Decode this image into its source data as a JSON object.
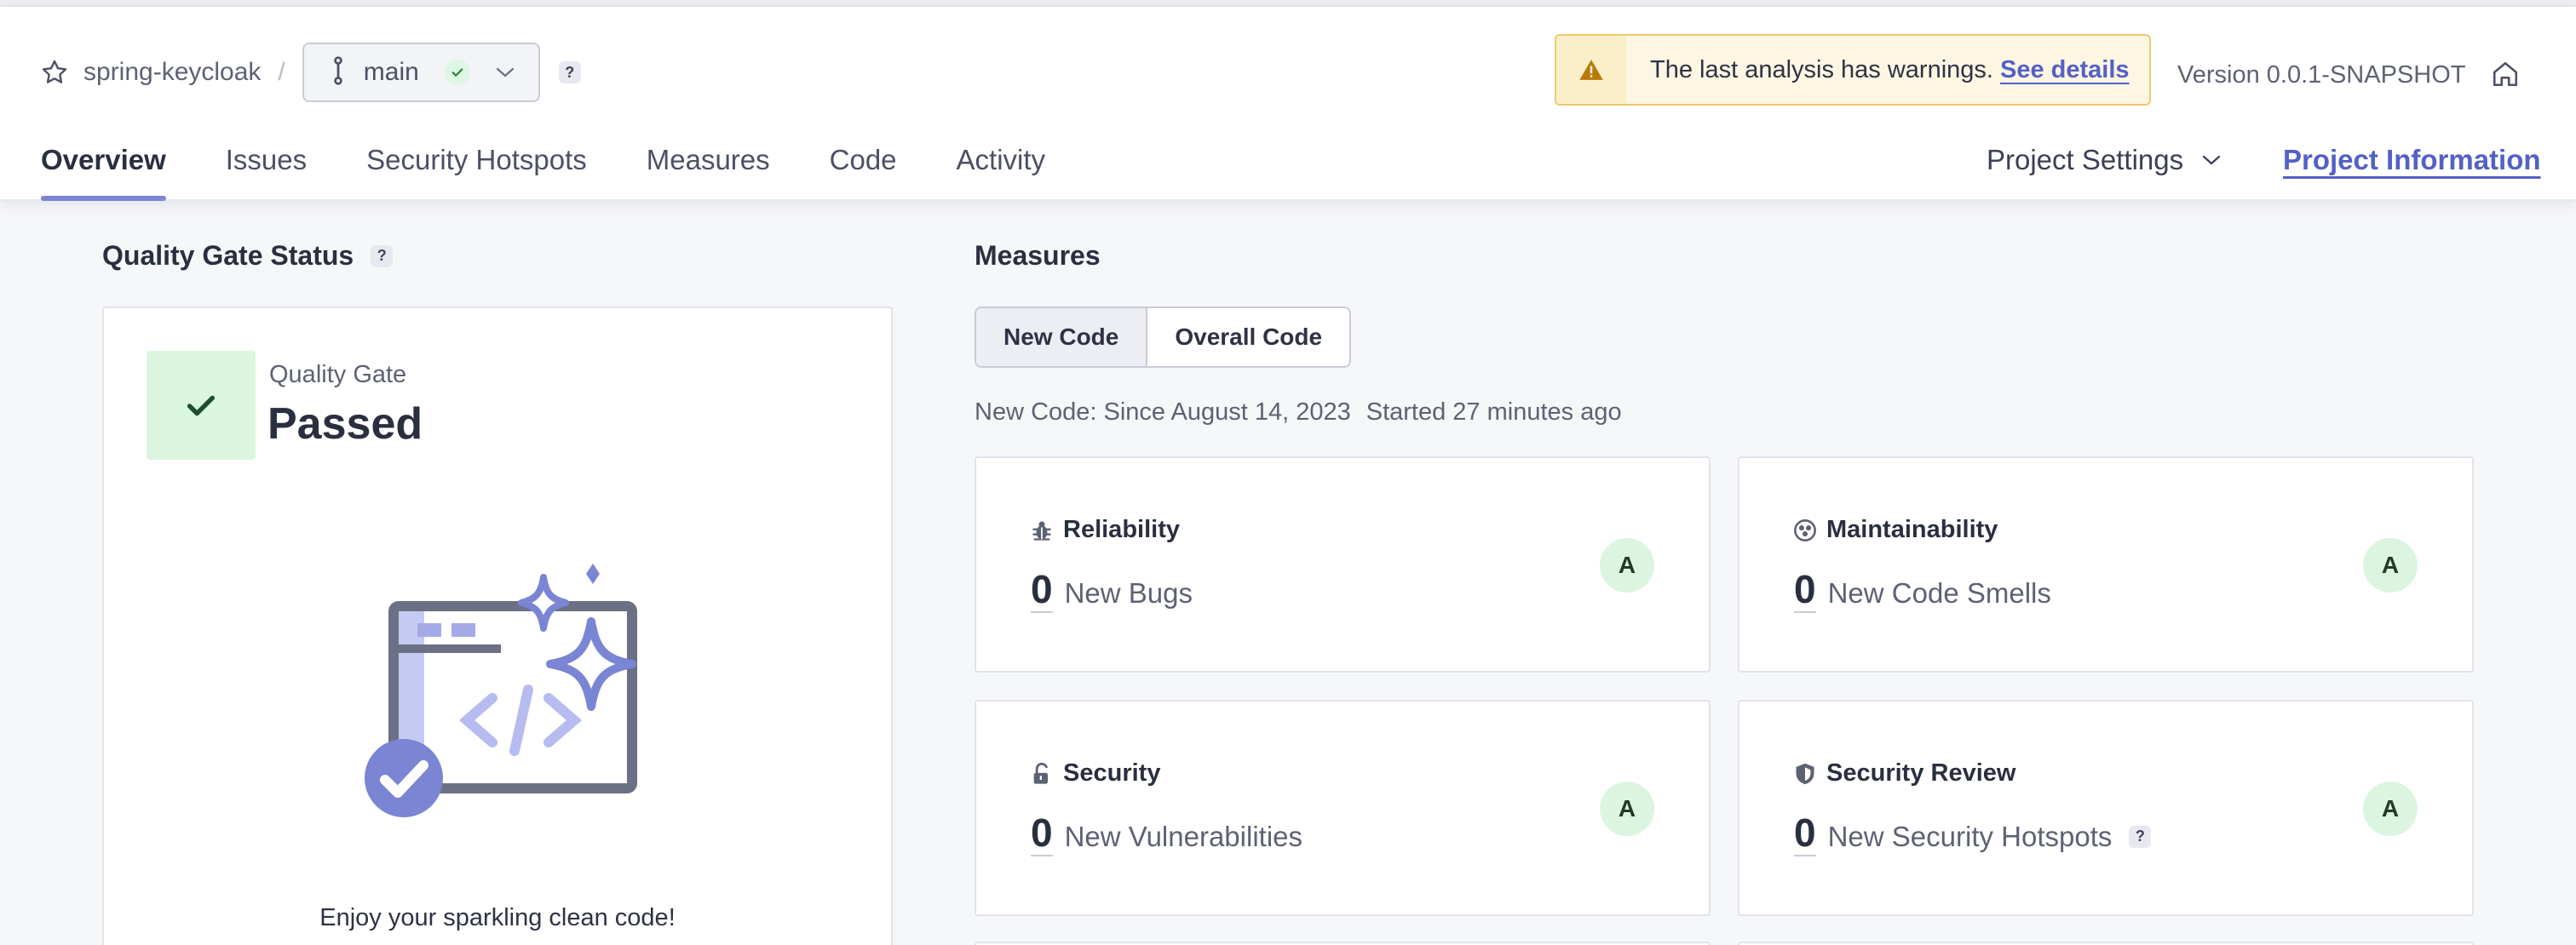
{
  "header": {
    "project_name": "spring-keycloak",
    "separator": "/",
    "branch": {
      "name": "main",
      "status": "passed"
    },
    "help": "?",
    "warning": {
      "text": "The last analysis has warnings.",
      "link": "See details"
    },
    "version": "Version 0.0.1-SNAPSHOT",
    "tabs": [
      {
        "label": "Overview",
        "active": true
      },
      {
        "label": "Issues"
      },
      {
        "label": "Security Hotspots"
      },
      {
        "label": "Measures"
      },
      {
        "label": "Code"
      },
      {
        "label": "Activity"
      }
    ],
    "project_settings": "Project Settings",
    "project_information": "Project Information"
  },
  "quality_gate": {
    "title": "Quality Gate Status",
    "help": "?",
    "label": "Quality Gate",
    "status": "Passed",
    "footer": "Enjoy your sparkling clean code!"
  },
  "measures": {
    "title": "Measures",
    "toggle": {
      "new_code": "New Code",
      "overall_code": "Overall Code",
      "selected": "New Code"
    },
    "since": "New Code: Since August 14, 2023",
    "started": "Started 27 minutes ago",
    "cards": [
      {
        "title": "Reliability",
        "icon": "bug-icon",
        "value": "0",
        "label": "New Bugs",
        "rating": "A"
      },
      {
        "title": "Maintainability",
        "icon": "maintainability-icon",
        "value": "0",
        "label": "New Code Smells",
        "rating": "A"
      },
      {
        "title": "Security",
        "icon": "lock-icon",
        "value": "0",
        "label": "New Vulnerabilities",
        "rating": "A"
      },
      {
        "title": "Security Review",
        "icon": "shield-icon",
        "value": "0",
        "label": "New Security Hotspots",
        "rating": "A",
        "help": "?"
      }
    ]
  },
  "colors": {
    "accent": "#5460c6",
    "tab_underline": "#7a85d4",
    "success_bg": "#dbf6df",
    "warning_bg": "#fcf6e3",
    "warning_border": "#f0c96a"
  }
}
